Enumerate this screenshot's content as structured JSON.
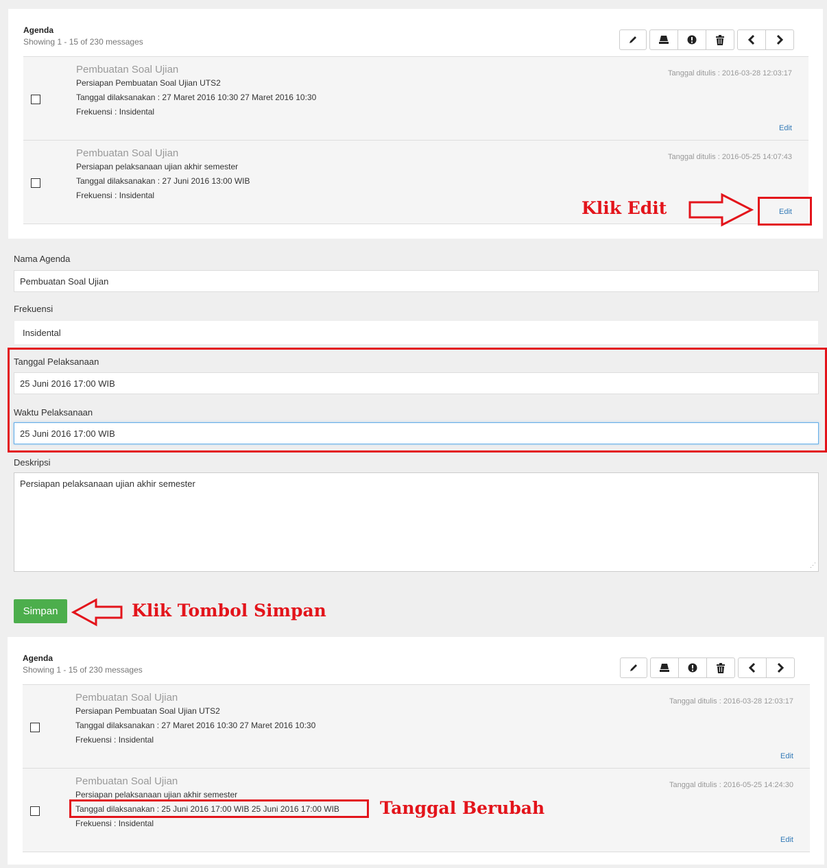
{
  "agenda": {
    "title": "Agenda",
    "subtitle": "Showing 1 - 15 of 230 messages"
  },
  "toolbar_icons": [
    "pencil-icon",
    "inbox-icon",
    "exclamation-icon",
    "trash-icon",
    "chevron-left-icon",
    "chevron-right-icon"
  ],
  "list_top": [
    {
      "title": "Pembuatan Soal Ujian",
      "desc": "Persiapan Pembuatan Soal Ujian UTS2",
      "date": "Tanggal dilaksanakan : 27 Maret 2016 10:30 27 Maret 2016 10:30",
      "freq": "Frekuensi : Insidental",
      "written": "Tanggal ditulis : 2016-03-28 12:03:17",
      "edit": "Edit"
    },
    {
      "title": "Pembuatan Soal Ujian",
      "desc": "Persiapan pelaksanaan ujian akhir semester",
      "date": "Tanggal dilaksanakan : 27 Juni 2016 13:00 WIB",
      "freq": "Frekuensi : Insidental",
      "written": "Tanggal ditulis : 2016-05-25 14:07:43",
      "edit": "Edit"
    }
  ],
  "form": {
    "nama_label": "Nama Agenda",
    "nama_value": "Pembuatan Soal Ujian",
    "frekuensi_label": "Frekuensi",
    "frekuensi_value": "Insidental",
    "tanggal_label": "Tanggal Pelaksanaan",
    "tanggal_value": "25 Juni 2016 17:00 WIB",
    "waktu_label": "Waktu Pelaksanaan",
    "waktu_value": "25 Juni 2016 17:00 WIB",
    "deskripsi_label": "Deskripsi",
    "deskripsi_value": "Persiapan pelaksanaan ujian akhir semester",
    "simpan_label": "Simpan"
  },
  "list_bottom": [
    {
      "title": "Pembuatan Soal Ujian",
      "desc": "Persiapan Pembuatan Soal Ujian UTS2",
      "date": "Tanggal dilaksanakan : 27 Maret 2016 10:30 27 Maret 2016 10:30",
      "freq": "Frekuensi : Insidental",
      "written": "Tanggal ditulis : 2016-03-28 12:03:17",
      "edit": "Edit"
    },
    {
      "title": "Pembuatan Soal Ujian",
      "desc": "Persiapan pelaksanaan ujian akhir semester",
      "date": "Tanggal dilaksanakan : 25 Juni 2016 17:00 WIB 25 Juni 2016 17:00 WIB",
      "freq": "Frekuensi : Insidental",
      "written": "Tanggal ditulis : 2016-05-25 14:24:30",
      "edit": "Edit"
    }
  ],
  "annotations": {
    "klik_edit": "Klik Edit",
    "klik_simpan": "Klik Tombol Simpan",
    "tanggal_berubah": "Tanggal Berubah",
    "color": "#e3141b"
  }
}
